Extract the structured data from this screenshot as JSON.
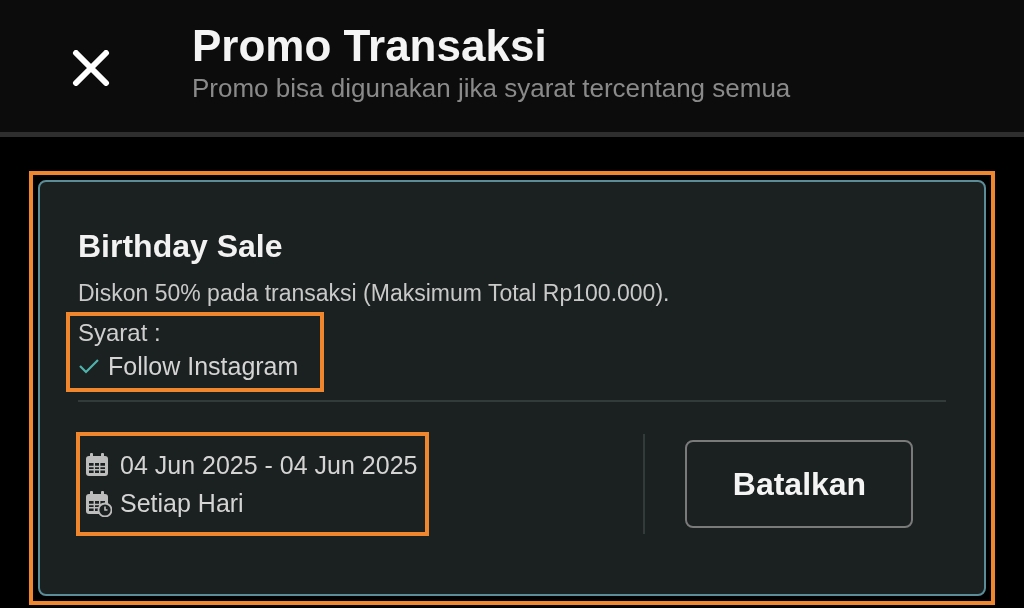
{
  "header": {
    "title": "Promo Transaksi",
    "subtitle": "Promo bisa digunakan jika syarat tercentang semua"
  },
  "promo": {
    "title": "Birthday Sale",
    "description": "Diskon 50% pada transaksi (Maksimum Total Rp100.000).",
    "requirements_label": "Syarat :",
    "requirements": [
      {
        "label": "Follow Instagram",
        "checked": true
      }
    ],
    "period": "04 Jun 2025 - 04 Jun 2025",
    "schedule": "Setiap Hari",
    "button": "Batalkan"
  }
}
